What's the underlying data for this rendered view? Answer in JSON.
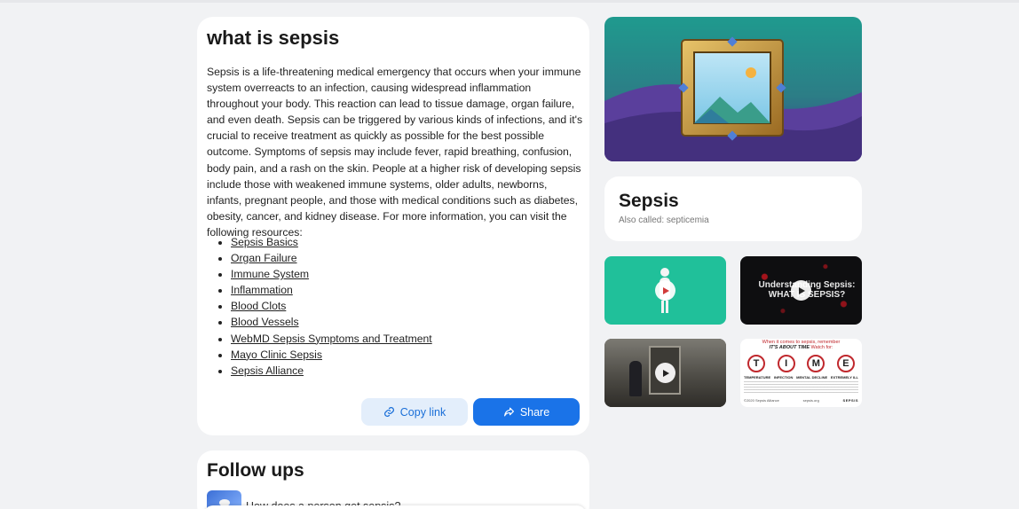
{
  "answer": {
    "title": "what is sepsis",
    "body": "Sepsis is a life-threatening medical emergency that occurs when your immune system overreacts to an infection, causing widespread inflammation throughout your body. This reaction can lead to tissue damage, organ failure, and even death. Sepsis can be triggered by various kinds of infections, and it's crucial to receive treatment as quickly as possible for the best possible outcome. Symptoms of sepsis may include fever, rapid breathing, confusion, body pain, and a rash on the skin. People at a higher risk of developing sepsis include those with weakened immune systems, older adults, newborns, infants, pregnant people, and those with medical conditions such as diabetes, obesity, cancer, and kidney disease. For more information, you can visit the following resources:",
    "resources": [
      "Sepsis Basics",
      "Organ Failure",
      "Immune System",
      "Inflammation",
      "Blood Clots",
      "Blood Vessels",
      "WebMD Sepsis Symptoms and Treatment",
      "Mayo Clinic Sepsis",
      "Sepsis Alliance"
    ],
    "copy_label": "Copy link",
    "share_label": "Share"
  },
  "followups": {
    "title": "Follow ups",
    "items": [
      "How does a person get sepsis?"
    ]
  },
  "knowledge_panel": {
    "title": "Sepsis",
    "subtitle": "Also called: septicemia"
  },
  "media": {
    "video2_caption": "Understanding Sepsis: WHAT IS SEPSIS?",
    "infographic": {
      "header": "When it comes to sepsis, remember",
      "tagline": "IT'S ABOUT TIME",
      "watch_for": "Watch for:",
      "letters": [
        "T",
        "I",
        "M",
        "E"
      ],
      "labels": [
        "TEMPERATURE",
        "INFECTION",
        "MENTAL DECLINE",
        "EXTREMELY ILL"
      ],
      "footer_left": "©2020 Sepsis Alliance",
      "footer_mid": "sepsis.org",
      "footer_brand": "SEPSIS"
    }
  },
  "colors": {
    "accent": "#1a73e8",
    "copy_bg": "#e3eefb",
    "background": "#f1f2f4",
    "thumb_green": "#20c09a",
    "alert_red": "#c0282d"
  },
  "icons": {
    "copy": "link-icon",
    "share": "share-arrow-icon",
    "play": "play-icon"
  }
}
